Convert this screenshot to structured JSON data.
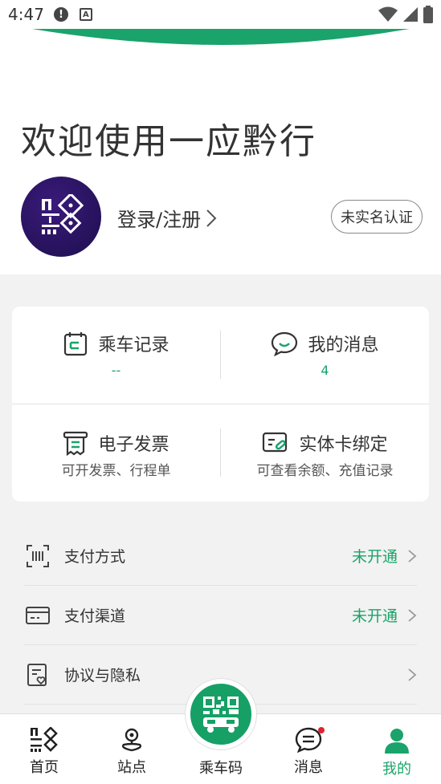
{
  "status_bar": {
    "time": "4:47"
  },
  "header": {
    "welcome": "欢迎使用一应黔行",
    "login_label": "登录/注册",
    "realname_badge": "未实名认证"
  },
  "quick_card": {
    "ride_records": {
      "label": "乘车记录",
      "value": "--"
    },
    "my_messages": {
      "label": "我的消息",
      "value": "4"
    },
    "e_invoice": {
      "label": "电子发票",
      "sub": "可开发票、行程单"
    },
    "card_binding": {
      "label": "实体卡绑定",
      "sub": "可查看余额、充值记录"
    }
  },
  "menu": [
    {
      "label": "支付方式",
      "status": "未开通"
    },
    {
      "label": "支付渠道",
      "status": "未开通"
    },
    {
      "label": "协议与隐私",
      "status": ""
    }
  ],
  "tabbar": {
    "home": "首页",
    "station": "站点",
    "ride_code": "乘车码",
    "messages": "消息",
    "mine": "我的"
  },
  "colors": {
    "accent": "#1aa36a",
    "brand_purple": "#2a1466",
    "badge_red": "#e0232f"
  },
  "icons": [
    "notification-icon",
    "a-icon",
    "wifi-icon",
    "signal-icon",
    "battery-icon",
    "calendar-icon",
    "chat-icon",
    "receipt-icon",
    "card-link-icon",
    "barcode-icon",
    "wallet-icon",
    "doc-heart-icon",
    "home-logo-icon",
    "location-pin-icon",
    "qr-bus-icon",
    "message-icon",
    "user-icon",
    "chevron-right-icon"
  ]
}
